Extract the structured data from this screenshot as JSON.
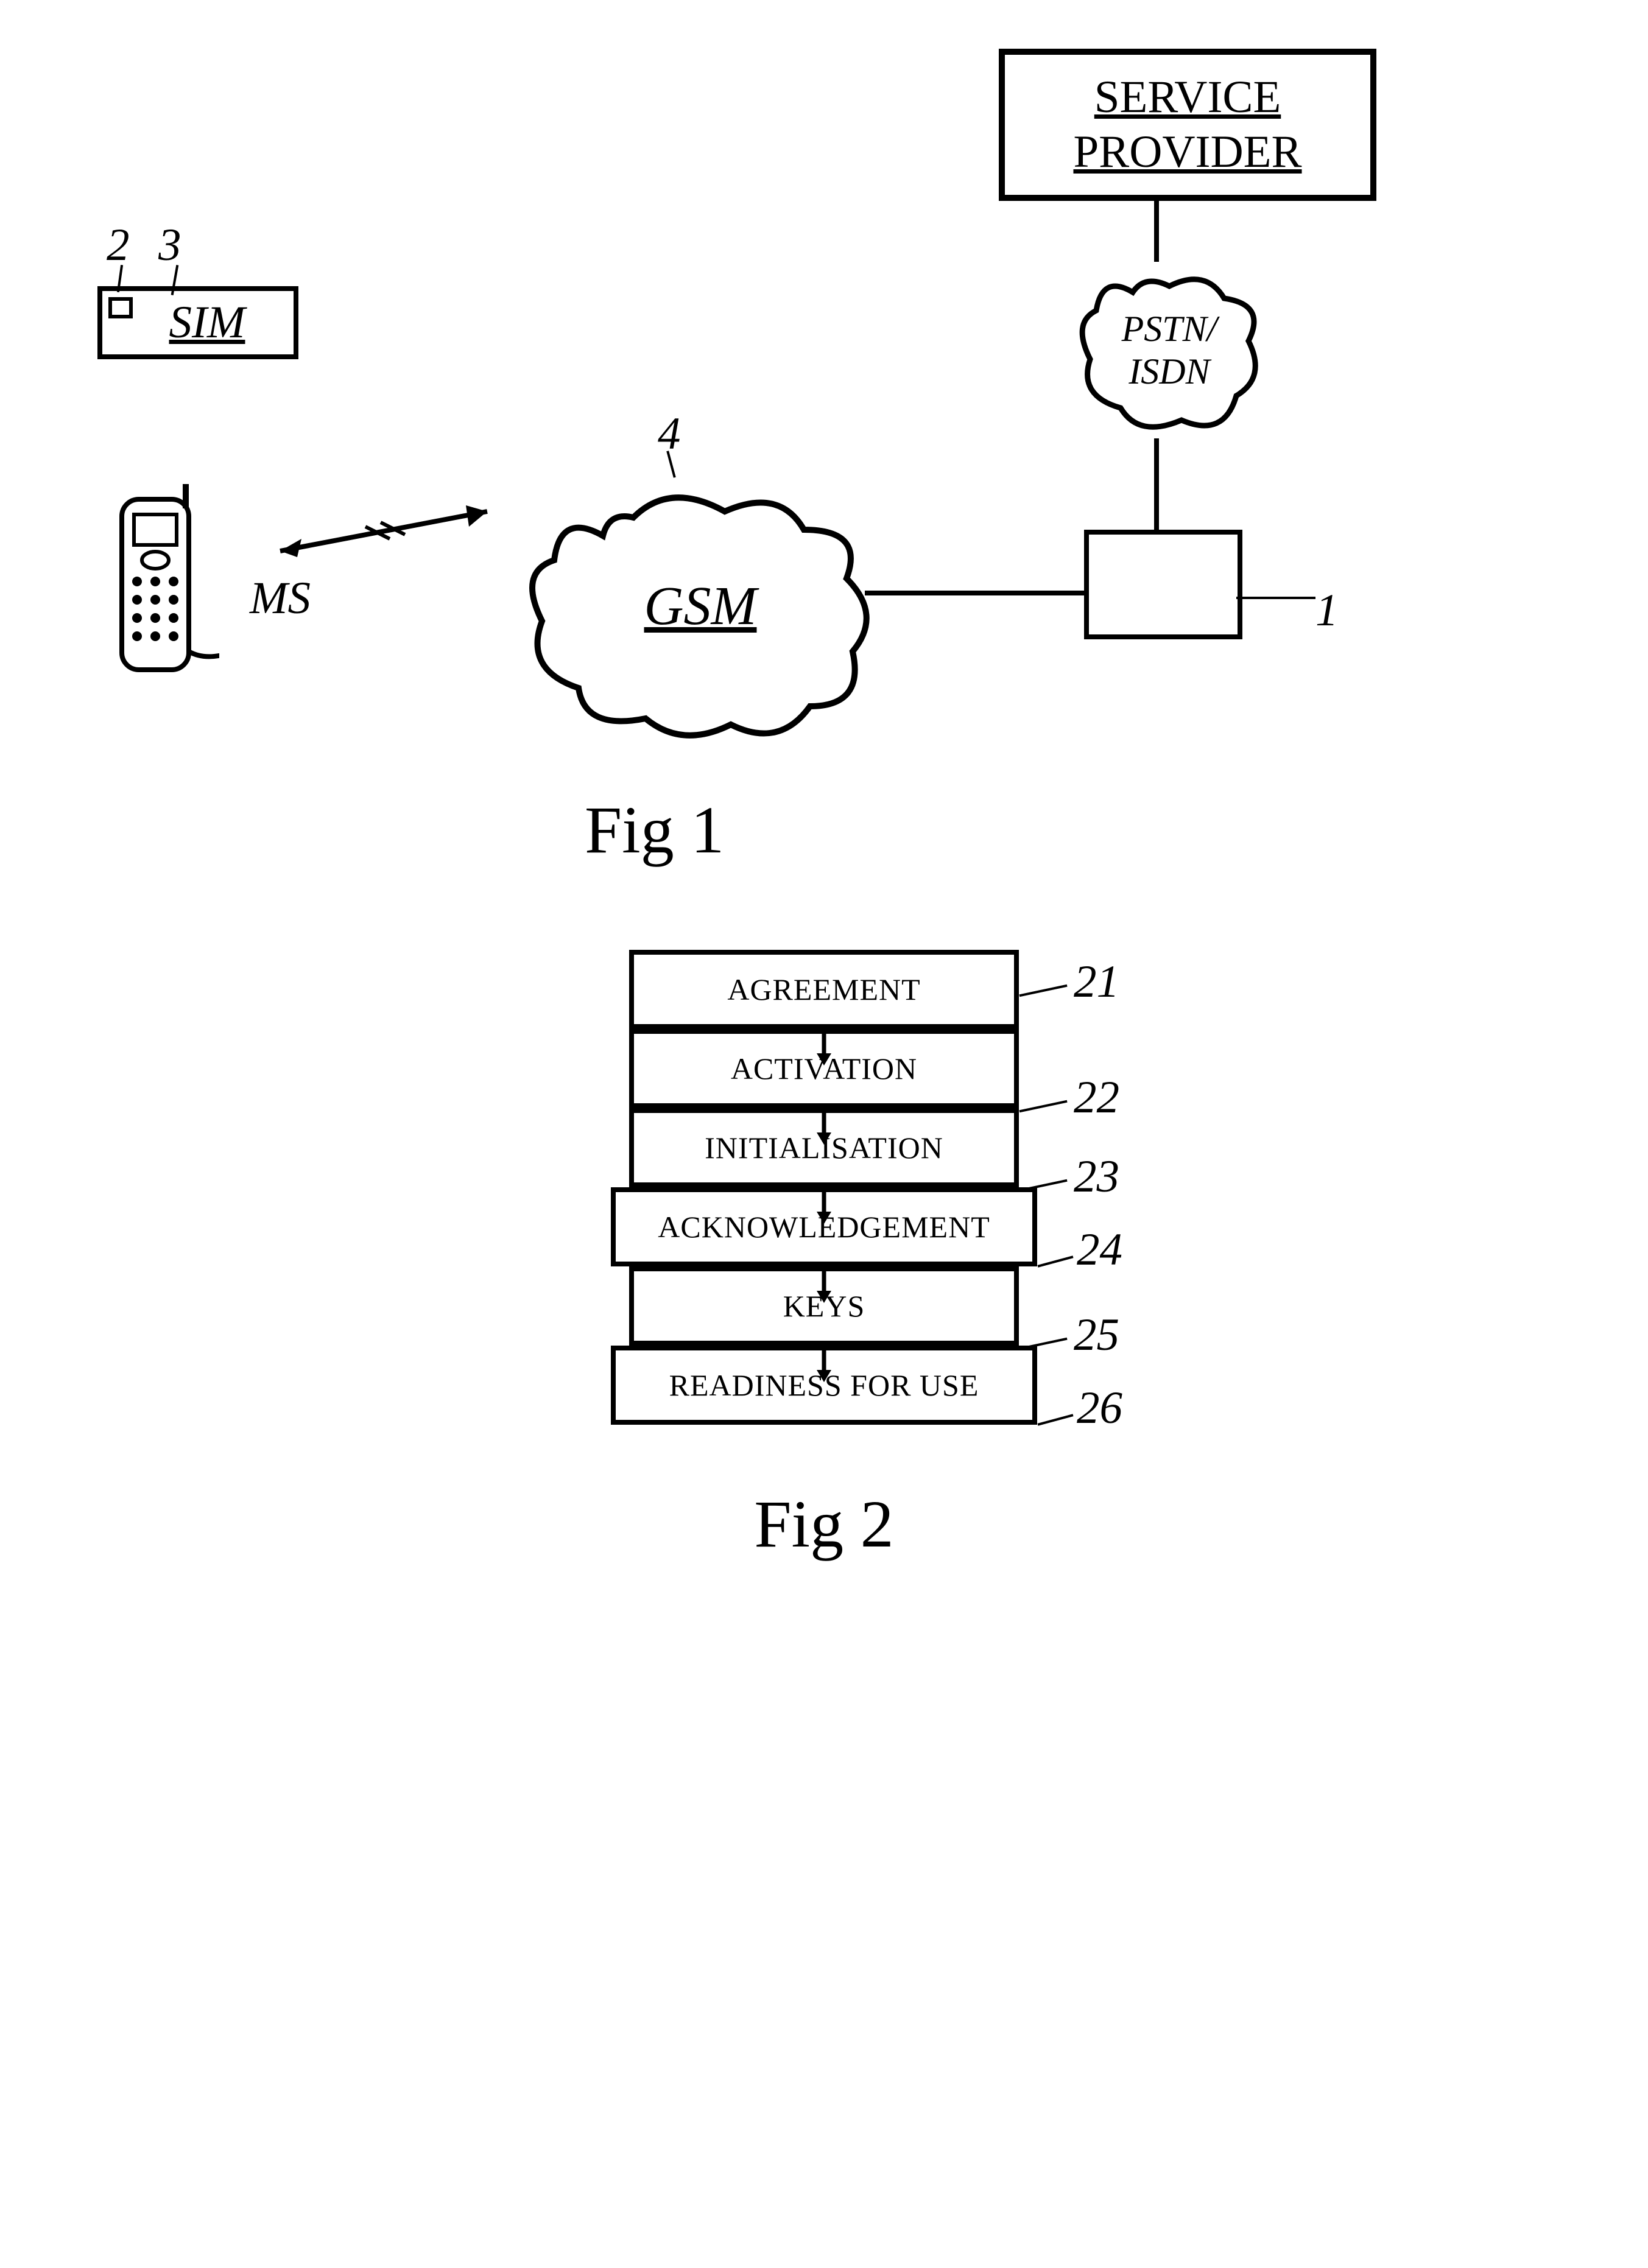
{
  "fig1": {
    "caption": "Fig 1",
    "service_provider": "SERVICE PROVIDER",
    "sim": "SIM",
    "ms": "MS",
    "gsm": "GSM",
    "pstn_isdn_line1": "PSTN/",
    "pstn_isdn_line2": "ISDN",
    "labels": {
      "1": "1",
      "2": "2",
      "3": "3",
      "4": "4"
    }
  },
  "fig2": {
    "caption": "Fig 2",
    "steps": [
      {
        "id": "21",
        "label": "AGREEMENT"
      },
      {
        "id": "22",
        "label": "ACTIVATION"
      },
      {
        "id": "23",
        "label": "INITIALISATION"
      },
      {
        "id": "24",
        "label": "ACKNOWLEDGEMENT"
      },
      {
        "id": "25",
        "label": "KEYS"
      },
      {
        "id": "26",
        "label": "READINESS FOR USE"
      }
    ]
  }
}
